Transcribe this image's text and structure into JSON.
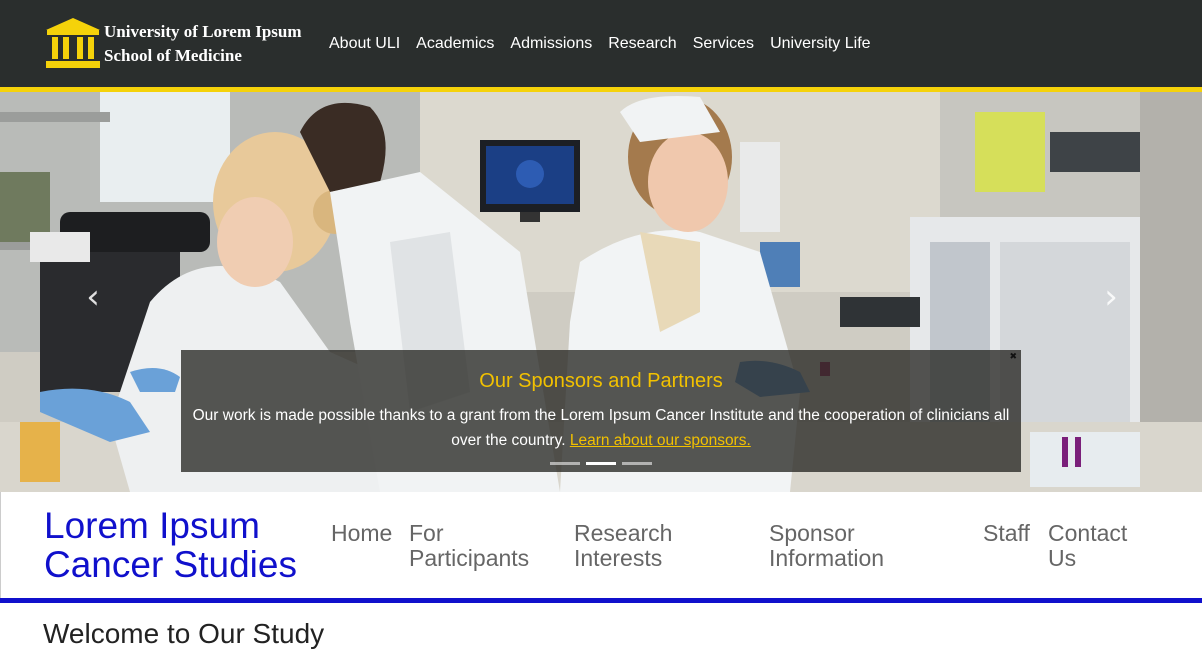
{
  "topbar": {
    "logo_line1": "University of Lorem Ipsum",
    "logo_line2": "School of Medicine",
    "nav": [
      "About ULI",
      "Academics",
      "Admissions",
      "Research",
      "Services",
      "University Life"
    ]
  },
  "carousel": {
    "caption_title": "Our Sponsors and Partners",
    "caption_text": "Our work is made possible thanks to a grant from the Lorem Ipsum Cancer Institute and the cooperation of clinicians all over the country.",
    "caption_link": "Learn about our sponsors.",
    "prev_icon": "‹",
    "next_icon": "›",
    "close_icon": "✖",
    "slide_count": 3,
    "active_slide": 2
  },
  "site": {
    "title_line1": "Lorem Ipsum",
    "title_line2": "Cancer Studies",
    "nav": {
      "home": "Home",
      "participants": "For Participants",
      "research": "Research Interests",
      "sponsor": "Sponsor Information",
      "staff": "Staff",
      "contact": "Contact Us"
    }
  },
  "main": {
    "welcome": "Welcome to Our Study"
  },
  "colors": {
    "topbar": "#2a2e2d",
    "accent_yellow": "#f5d20a",
    "site_blue": "#1010cc"
  }
}
